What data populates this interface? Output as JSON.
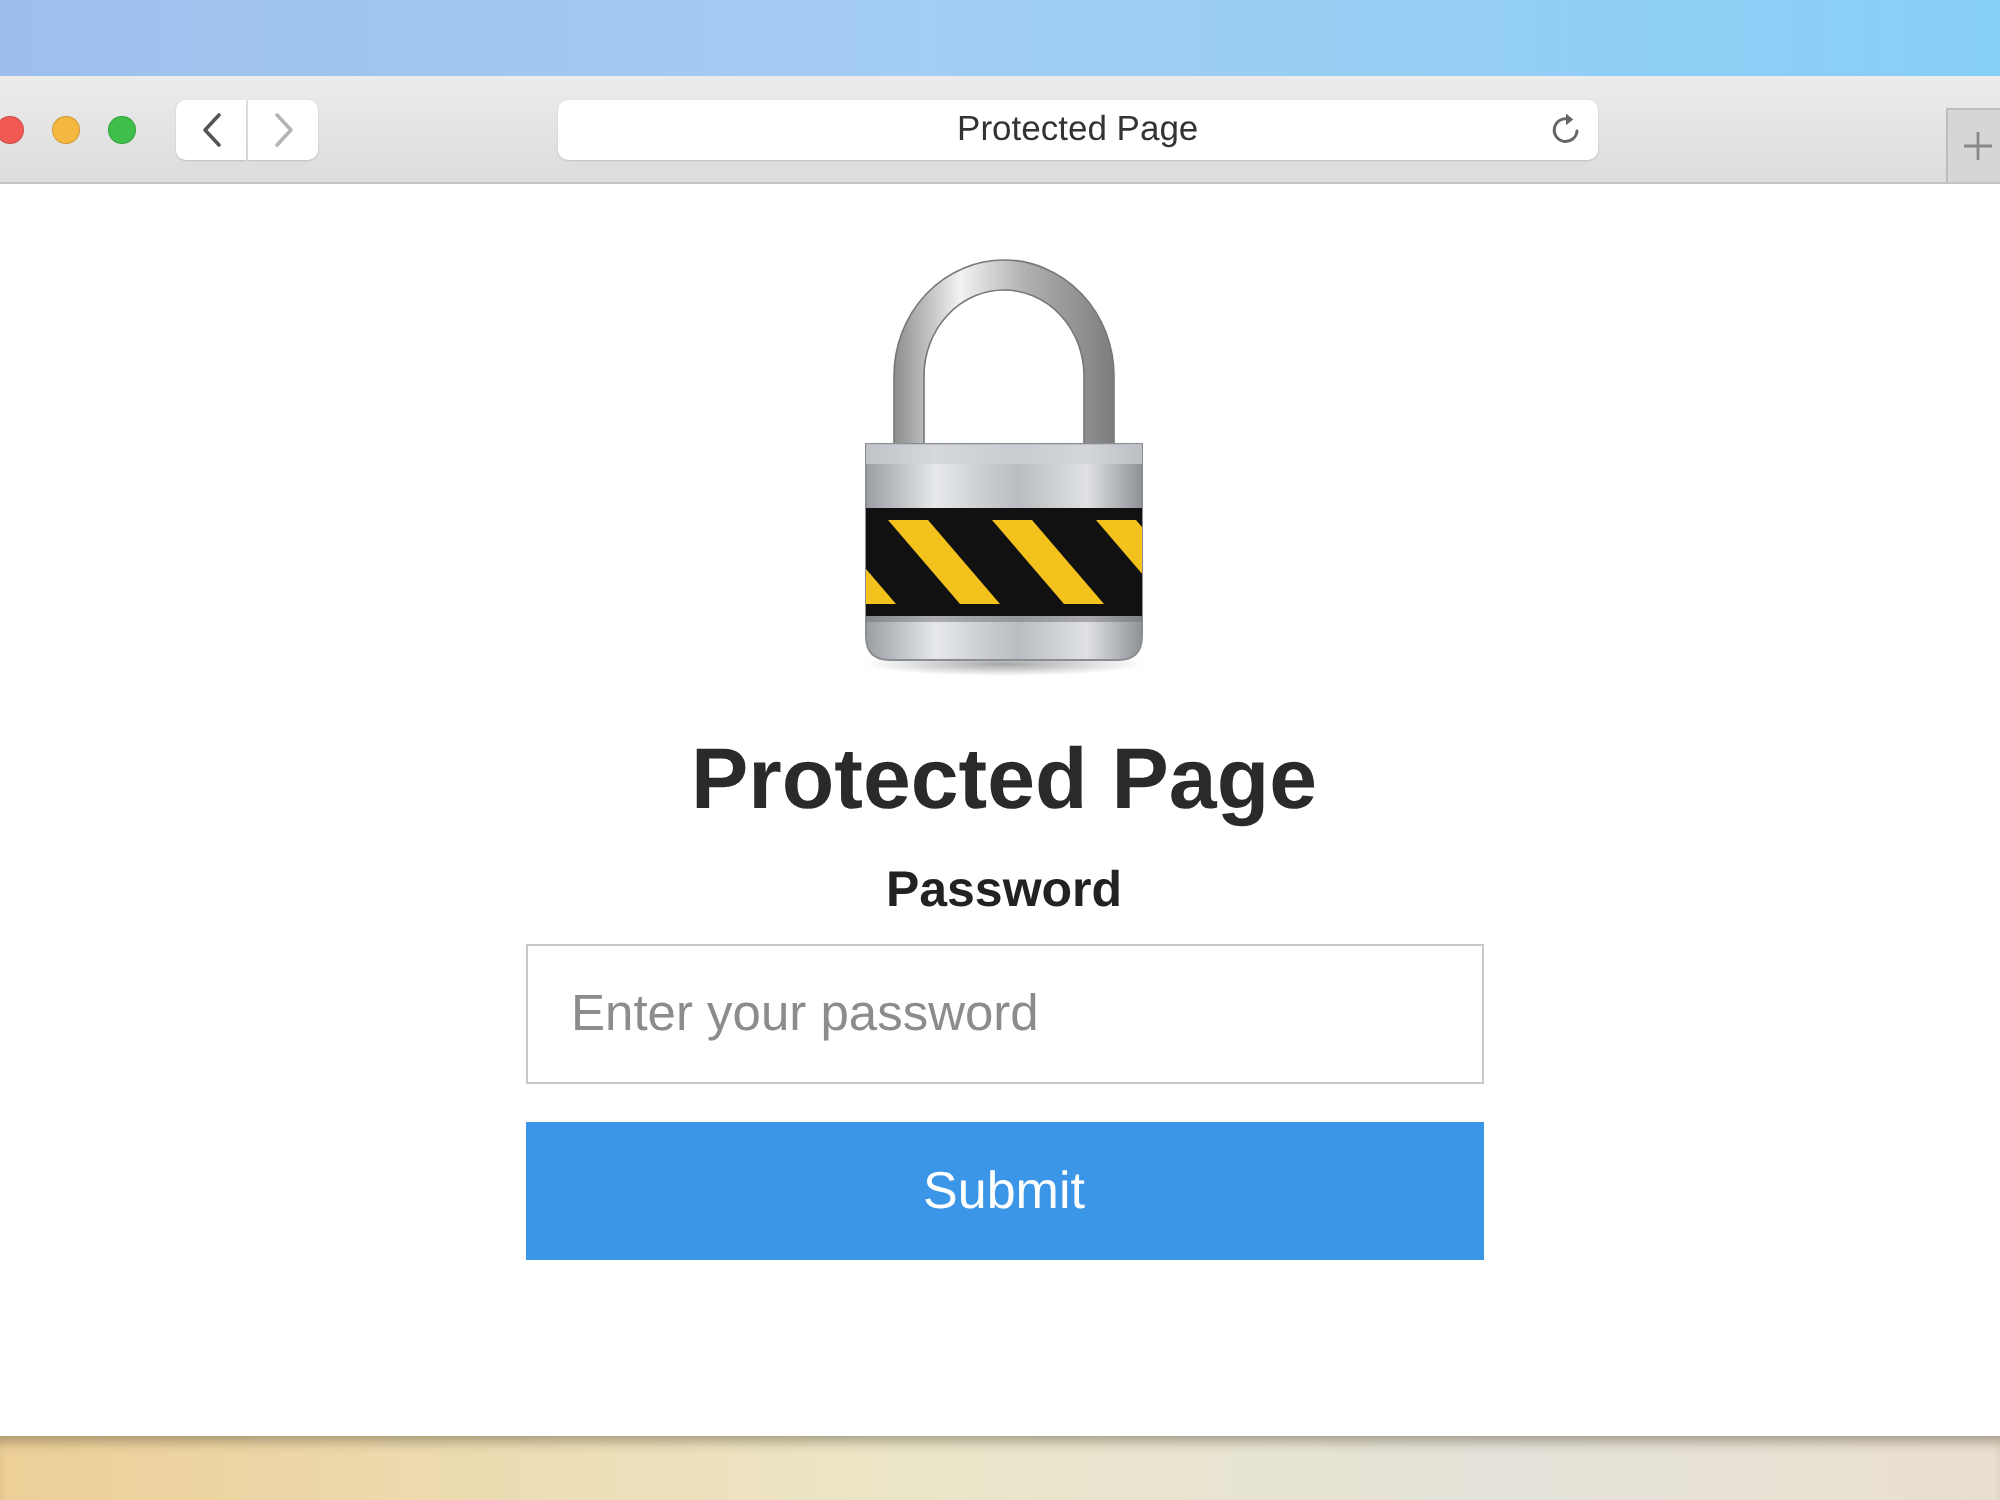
{
  "window_controls": [
    {
      "color": "#f05a52"
    },
    {
      "color": "#f4b73f"
    },
    {
      "color": "#3dbf4a"
    }
  ],
  "nav_buttons": [
    {
      "kind": "back",
      "disabled": false
    },
    {
      "kind": "forward",
      "disabled": true
    }
  ],
  "address_bar": {
    "text": "Protected Page"
  },
  "page": {
    "heading": "Protected Page",
    "password_label": "Password",
    "password_field": {
      "placeholder": "Enter your password"
    },
    "submit_button": "Submit"
  }
}
